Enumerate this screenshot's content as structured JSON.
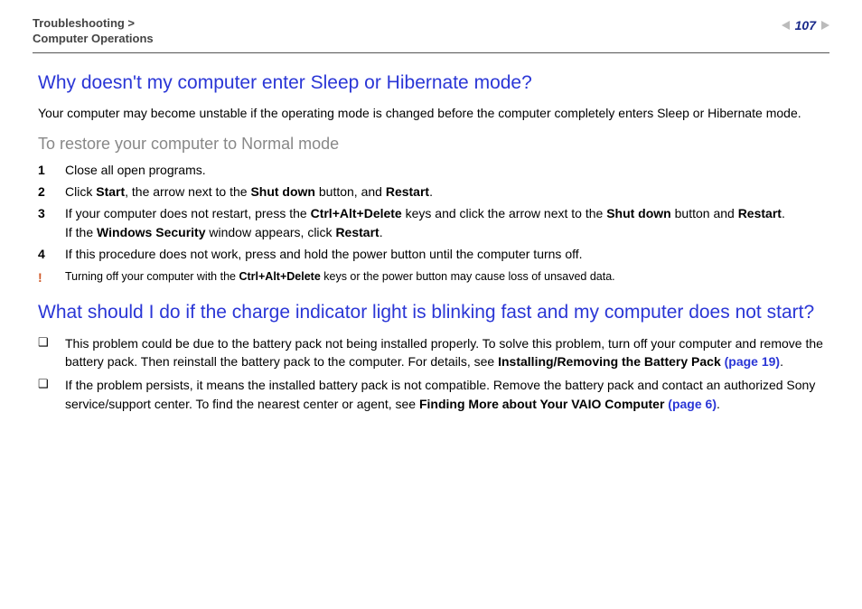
{
  "header": {
    "breadcrumb_line1": "Troubleshooting >",
    "breadcrumb_line2": "Computer Operations",
    "page_number": "107"
  },
  "q1": {
    "title": "Why doesn't my computer enter Sleep or Hibernate mode?",
    "intro": "Your computer may become unstable if the operating mode is changed before the computer completely enters Sleep or Hibernate mode.",
    "subhead": "To restore your computer to Normal mode",
    "steps": {
      "s1": {
        "num": "1",
        "text": "Close all open programs."
      },
      "s2": {
        "num": "2",
        "pre": "Click ",
        "b1": "Start",
        "mid1": ", the arrow next to the ",
        "b2": "Shut down",
        "mid2": " button, and ",
        "b3": "Restart",
        "post": "."
      },
      "s3": {
        "num": "3",
        "line1_pre": "If your computer does not restart, press the ",
        "kb": "Ctrl+Alt+Delete",
        "line1_mid": " keys and click the arrow next to the ",
        "b_sd": "Shut down",
        "line1_mid2": " button and ",
        "b_rs": "Restart",
        "line1_end": ".",
        "line2_pre": "If the ",
        "b_ws": "Windows Security",
        "line2_mid": " window appears, click ",
        "b_rs2": "Restart",
        "line2_end": "."
      },
      "s4": {
        "num": "4",
        "text": "If this procedure does not work, press and hold the power button until the computer turns off."
      }
    },
    "warning": {
      "bang": "!",
      "pre": "Turning off your computer with the ",
      "kb": "Ctrl+Alt+Delete",
      "post": " keys or the power button may cause loss of unsaved data."
    }
  },
  "q2": {
    "title": "What should I do if the charge indicator light is blinking fast and my computer does not start?",
    "b1": {
      "pre": "This problem could be due to the battery pack not being installed properly. To solve this problem, turn off your computer and remove the battery pack. Then reinstall the battery pack to the computer. For details, see ",
      "link_label": "Installing/Removing the Battery Pack",
      "page_ref": " (page 19)",
      "post": "."
    },
    "b2": {
      "pre": "If the problem persists, it means the installed battery pack is not compatible. Remove the battery pack and contact an authorized Sony service/support center. To find the nearest center or agent, see ",
      "link_label": "Finding More about Your VAIO Computer",
      "page_ref": " (page 6)",
      "post": "."
    }
  }
}
